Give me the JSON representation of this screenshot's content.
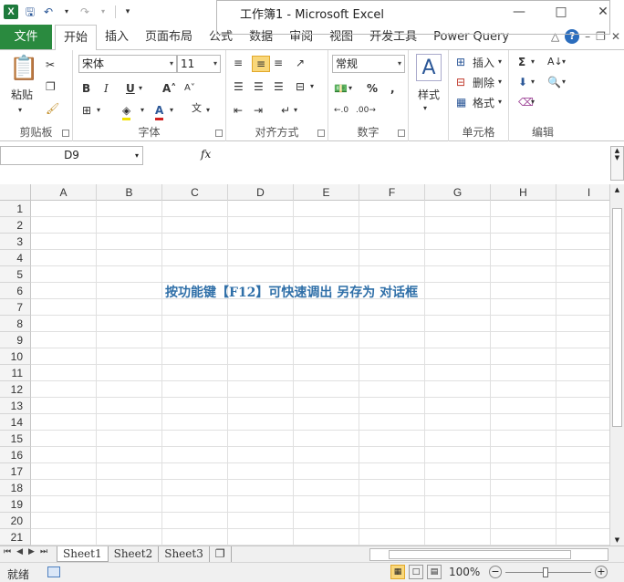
{
  "window": {
    "title": "工作簿1 - Microsoft Excel",
    "app_icon": "X",
    "controls": [
      "minimize-icon",
      "maximize-icon",
      "close-icon"
    ]
  },
  "ribbon_tabs": {
    "file": "文件",
    "items": [
      "开始",
      "插入",
      "页面布局",
      "公式",
      "数据",
      "审阅",
      "视图",
      "开发工具",
      "Power Query"
    ],
    "active": "开始"
  },
  "ribbon": {
    "clipboard": {
      "label": "剪贴板",
      "paste": "粘贴"
    },
    "font": {
      "label": "字体",
      "name": "宋体",
      "size": "11"
    },
    "alignment": {
      "label": "对齐方式"
    },
    "number": {
      "label": "数字",
      "format": "常规"
    },
    "styles": {
      "label": "样式"
    },
    "cells": {
      "label": "单元格",
      "insert": "插入",
      "delete": "删除",
      "format": "格式"
    },
    "editing": {
      "label": "编辑"
    }
  },
  "formula_bar": {
    "name_box": "D9",
    "fx": "fx",
    "content": ""
  },
  "grid": {
    "columns": [
      "A",
      "B",
      "C",
      "D",
      "E",
      "F",
      "G",
      "H",
      "I"
    ],
    "rows": [
      "1",
      "2",
      "3",
      "4",
      "5",
      "6",
      "7",
      "8",
      "9",
      "10",
      "11",
      "12",
      "13",
      "14",
      "15",
      "16",
      "17",
      "18",
      "19",
      "20",
      "21"
    ],
    "note": "按功能键【F12】可快速调出 另存为 对话框"
  },
  "sheets": {
    "tabs": [
      "Sheet1",
      "Sheet2",
      "Sheet3"
    ],
    "active": "Sheet1"
  },
  "status": {
    "text": "就绪",
    "zoom": "100%"
  }
}
